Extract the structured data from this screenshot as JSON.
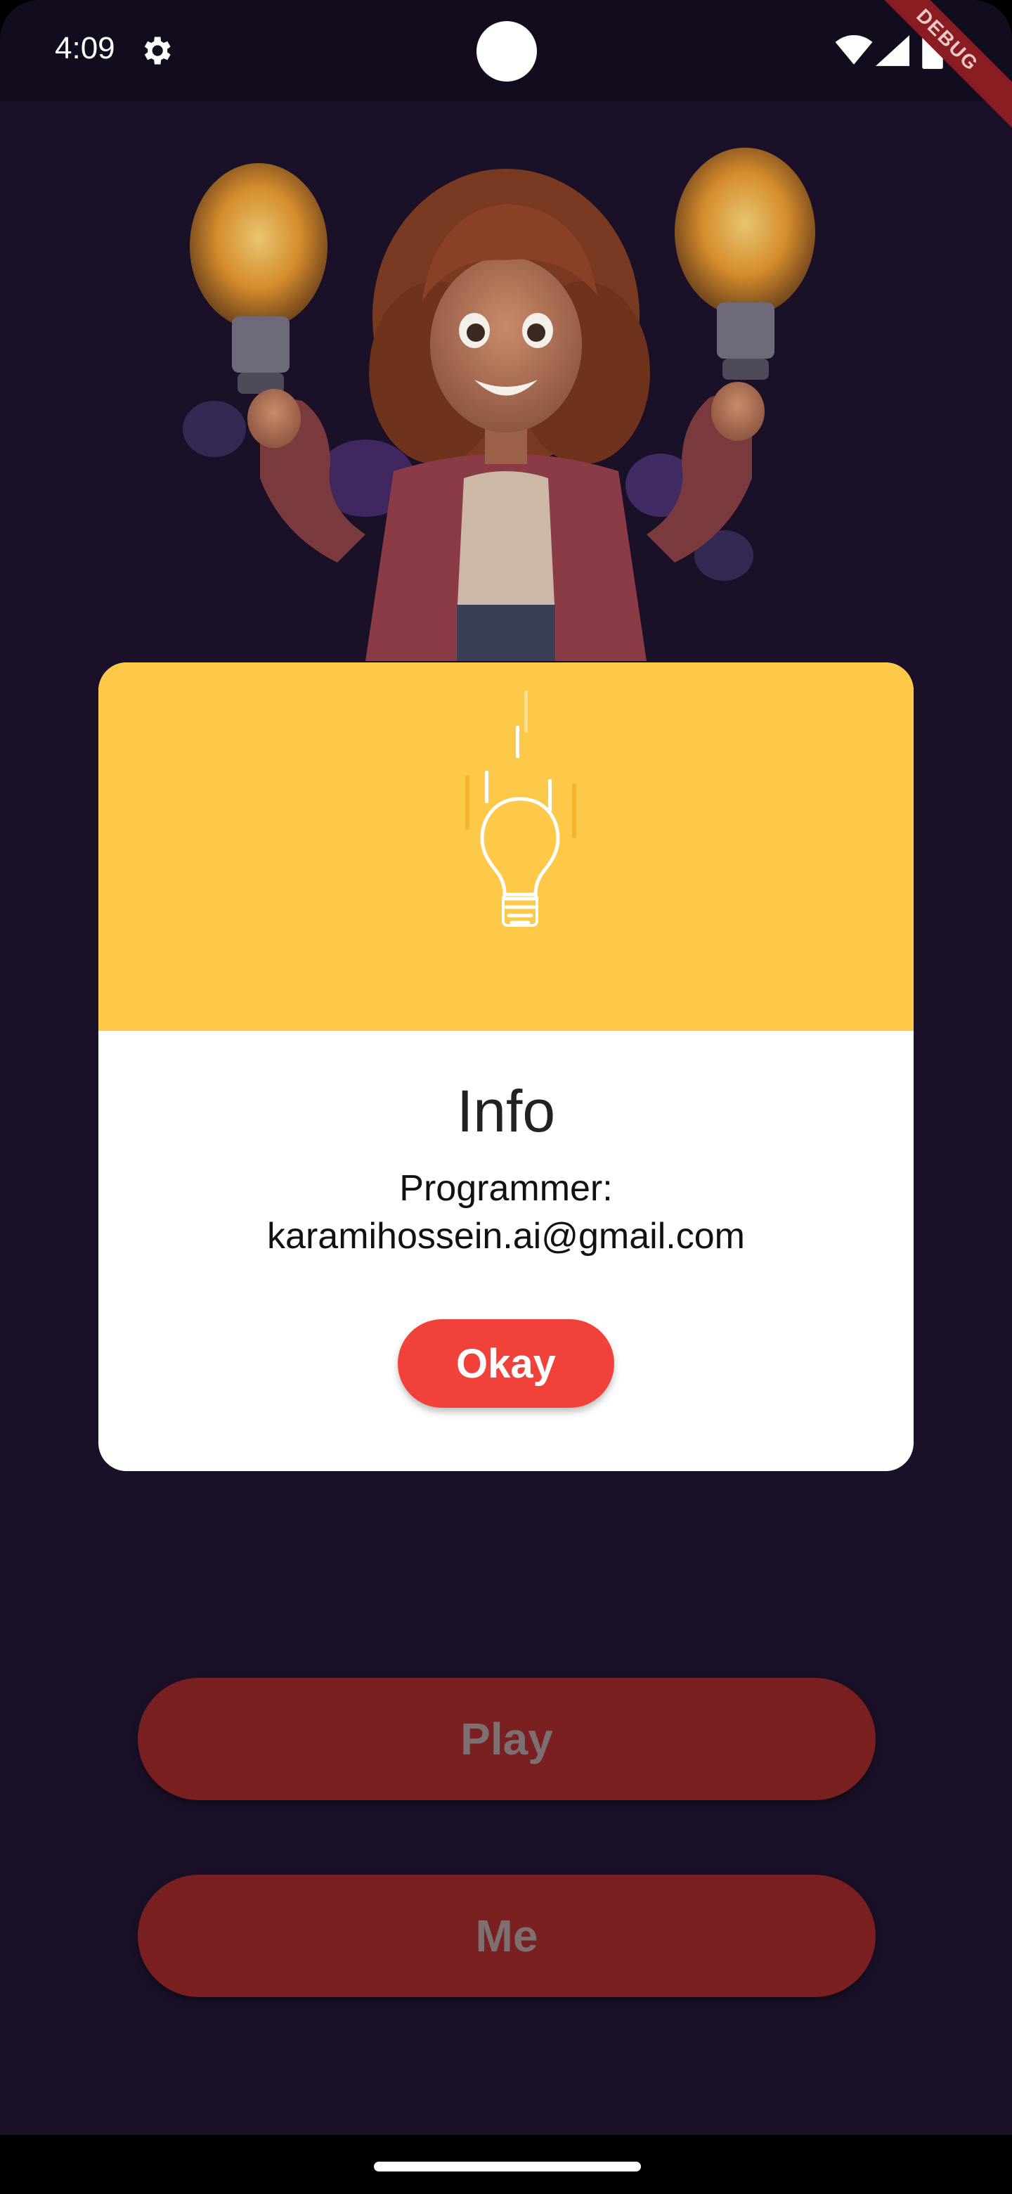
{
  "status_bar": {
    "time": "4:09",
    "debug_label": "DEBUG"
  },
  "dialog": {
    "title": "Info",
    "body_line1": "Programmer:",
    "body_line2": "karamihossein.ai@gmail.com",
    "okay_label": "Okay"
  },
  "buttons": {
    "play_label": "Play",
    "me_label": "Me"
  },
  "icons": {
    "settings": "gear-icon",
    "wifi": "wifi-icon",
    "signal": "cellular-signal-icon",
    "battery": "battery-icon",
    "header": "lightbulb-icon"
  },
  "colors": {
    "background": "#1a1129",
    "dialog_header": "#fec849",
    "okay_button": "#f0423a",
    "bottom_buttons": "#7a2020"
  }
}
